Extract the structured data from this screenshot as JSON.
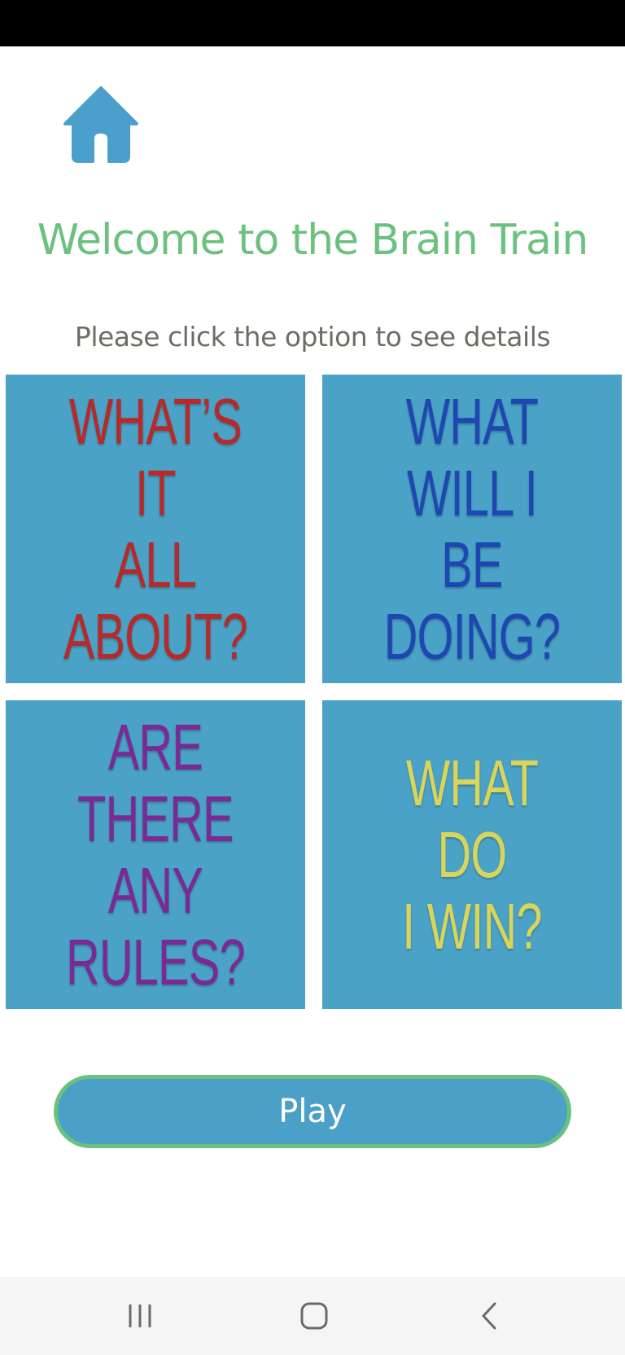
{
  "screen": {
    "title": "Welcome to the Brain Train",
    "subtitle": "Please click the option to see details"
  },
  "tiles": [
    {
      "label": "WHAT’S IT\nALL\nABOUT?",
      "color": "#b52a2a"
    },
    {
      "label": "WHAT\nWILL I BE\nDOING?",
      "color": "#1f47b1"
    },
    {
      "label": "ARE THERE\nANY\nRULES?",
      "color": "#7a2a94"
    },
    {
      "label": "WHAT\nDO\nI WIN?",
      "color": "#d9d55a"
    }
  ],
  "play_button": {
    "label": "Play"
  },
  "icons": {
    "home": "home-icon",
    "recents": "recents-icon",
    "nav_home": "nav-home-icon",
    "back": "back-icon"
  },
  "colors": {
    "accent_green": "#6cc17e",
    "tile_blue": "#4aa3c7",
    "home_icon": "#4a9fcb"
  }
}
